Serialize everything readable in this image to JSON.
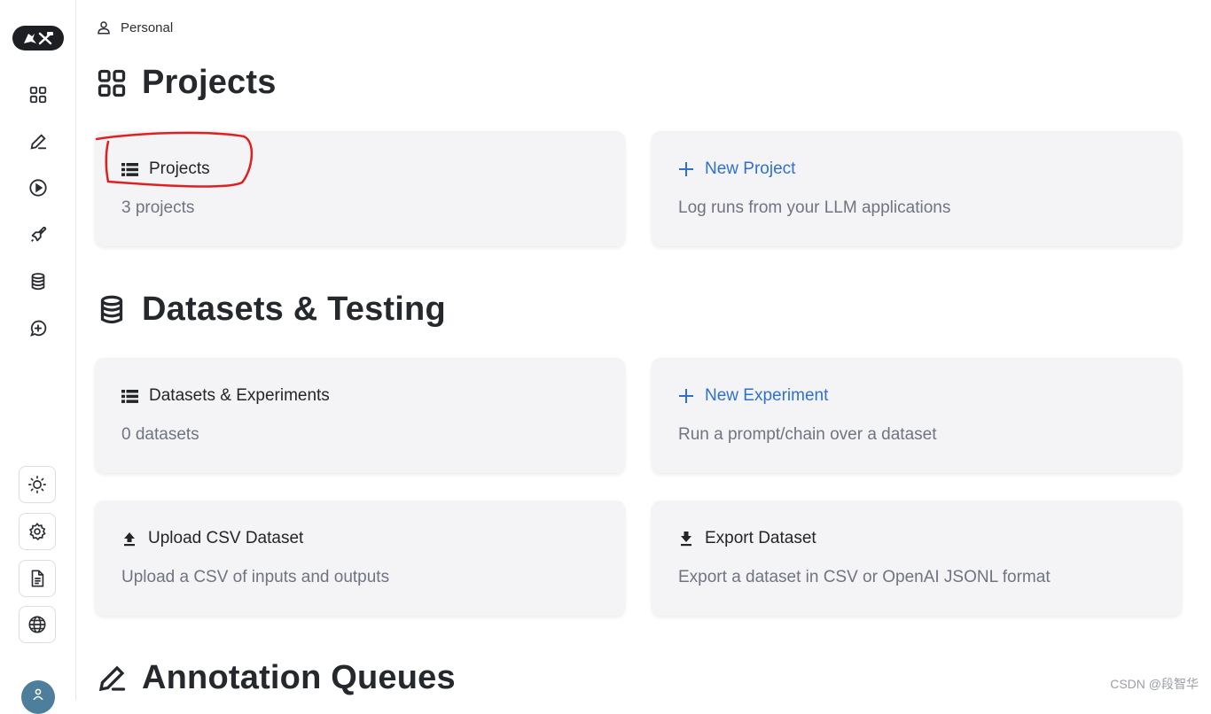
{
  "breadcrumb": {
    "label": "Personal"
  },
  "sections": {
    "projects": {
      "title": "Projects"
    },
    "datasets": {
      "title": "Datasets & Testing"
    },
    "annotation": {
      "title": "Annotation Queues"
    }
  },
  "cards": {
    "projects": {
      "title": "Projects",
      "subtitle": "3 projects"
    },
    "new_project": {
      "title": "New Project",
      "subtitle": "Log runs from your LLM applications"
    },
    "datasets": {
      "title": "Datasets & Experiments",
      "subtitle": "0 datasets"
    },
    "new_experiment": {
      "title": "New Experiment",
      "subtitle": "Run a prompt/chain over a dataset"
    },
    "upload_csv": {
      "title": "Upload CSV Dataset",
      "subtitle": "Upload a CSV of inputs and outputs"
    },
    "export_dataset": {
      "title": "Export Dataset",
      "subtitle": "Export a dataset in CSV or OpenAI JSONL format"
    }
  },
  "sidebar": {
    "nav": [
      "grid-icon",
      "pencil-icon",
      "play-icon",
      "rocket-icon",
      "database-icon",
      "chat-plus-icon"
    ],
    "utilities": [
      "sun-icon",
      "gear-icon",
      "document-icon",
      "globe-icon"
    ]
  },
  "colors": {
    "accent": "#2f6fd1",
    "card_bg": "#f4f4f6",
    "annotation": "#e02020"
  },
  "watermark": "CSDN @段智华"
}
